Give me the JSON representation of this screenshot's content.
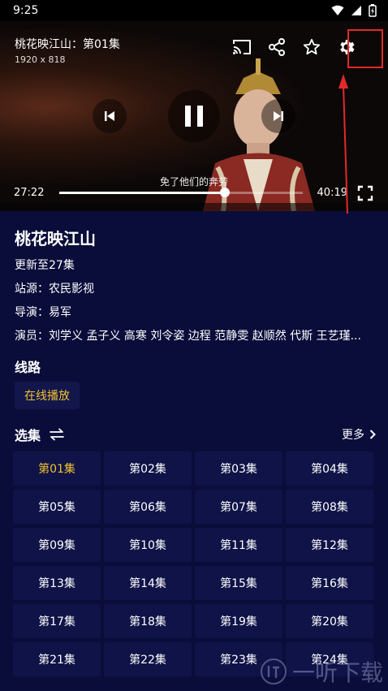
{
  "status_bar": {
    "time": "9:25"
  },
  "player": {
    "title": "桃花映江山：第01集",
    "resolution": "1920 x 818",
    "subtitle": "免了他们的奔劳",
    "current_time": "27:22",
    "total_time": "40:19",
    "progress_percent": 68
  },
  "show": {
    "title": "桃花映江山",
    "update_status": "更新至27集",
    "source": "站源：农民影视",
    "director": "导演：易军",
    "cast": "演员：刘学义 孟子义 高寒 刘令姿 边程 范静雯 赵顺然 代斯 王艺瑾..."
  },
  "routes": {
    "heading": "线路",
    "items": [
      "在线播放"
    ]
  },
  "episodes": {
    "heading": "选集",
    "more_label": "更多",
    "selected_index": 0,
    "items": [
      "第01集",
      "第02集",
      "第03集",
      "第04集",
      "第05集",
      "第06集",
      "第07集",
      "第08集",
      "第09集",
      "第10集",
      "第11集",
      "第12集",
      "第13集",
      "第14集",
      "第15集",
      "第16集",
      "第17集",
      "第18集",
      "第19集",
      "第20集",
      "第21集",
      "第22集",
      "第23集",
      "第24集"
    ]
  },
  "watermark": {
    "text": "一听下载"
  },
  "colors": {
    "background": "#0a0d3a",
    "accent": "#f1c232",
    "highlight_box": "#e02a2a",
    "episode_tile": "#0f1347"
  },
  "icons": [
    "wifi-icon",
    "signal-icon",
    "battery-icon",
    "cast-icon",
    "share-icon",
    "star-icon",
    "gear-icon",
    "skip-previous-icon",
    "pause-icon",
    "skip-next-icon",
    "fullscreen-icon",
    "swap-icon",
    "chevron-right-icon"
  ]
}
